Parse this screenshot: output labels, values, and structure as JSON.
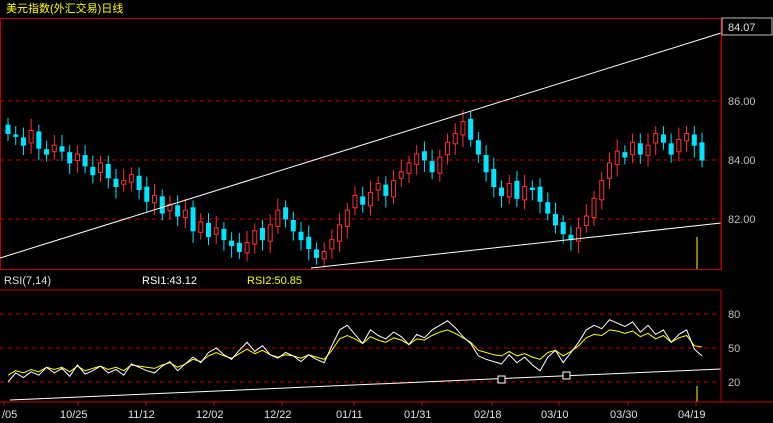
{
  "window_title": "美元指数(外汇交易)日线",
  "price_panel": {
    "current_price_label": "84.07",
    "y_ticks": [
      "86.00",
      "84.00",
      "82.00"
    ]
  },
  "rsi_panel": {
    "title": "RSI(7,14)",
    "rsi1_label": "RSI1:43.12",
    "rsi2_label": "RSI2:50.85",
    "y_ticks": [
      "80",
      "50",
      "20"
    ]
  },
  "x_axis_labels": [
    "/05",
    "10/25",
    "11/12",
    "12/02",
    "12/22",
    "01/11",
    "01/31",
    "02/18",
    "03/10",
    "03/30",
    "04/19"
  ],
  "colors": {
    "background": "#000000",
    "frame": "#c00000",
    "grid": "#c00000",
    "up_candle": "#ff3030",
    "down_candle": "#00e5ff",
    "title_text": "#ffff00",
    "axis_text": "#c0c0c0",
    "rsi1": "#ffffff",
    "rsi2": "#ffff00",
    "trendline": "#ffffff"
  },
  "chart_data": [
    {
      "type": "candlestick",
      "series": [
        {
          "name": "USD Index daily",
          "close": [
            84.9,
            84.8,
            84.5,
            85.0,
            84.4,
            84.2,
            84.5,
            84.3,
            83.9,
            84.2,
            83.8,
            83.5,
            83.9,
            83.4,
            83.1,
            83.3,
            83.5,
            83.0,
            82.6,
            82.8,
            82.2,
            82.5,
            82.1,
            82.3,
            81.6,
            81.9,
            81.4,
            81.7,
            81.3,
            81.1,
            80.9,
            81.2,
            81.6,
            81.3,
            81.8,
            82.3,
            82.0,
            81.6,
            81.3,
            81.0,
            80.7,
            80.9,
            81.3,
            81.8,
            82.3,
            82.8,
            82.5,
            82.9,
            83.2,
            82.8,
            83.3,
            83.6,
            83.9,
            84.2,
            84.0,
            83.6,
            84.1,
            84.6,
            84.9,
            85.3,
            84.7,
            84.2,
            83.6,
            83.1,
            82.8,
            83.2,
            82.7,
            83.1,
            83.0,
            82.6,
            82.2,
            81.8,
            81.5,
            81.3,
            81.7,
            82.1,
            82.7,
            83.3,
            83.9,
            84.3,
            84.1,
            84.6,
            84.2,
            84.5,
            84.9,
            84.6,
            84.2,
            84.7,
            84.9,
            84.5,
            84.0
          ]
        }
      ],
      "ylim": [
        80.6,
        87.8
      ],
      "y_ticks": [
        82.0,
        84.0,
        86.0
      ],
      "last_price": 84.07,
      "trendlines": [
        "upper channel line",
        "lower channel line"
      ],
      "grid": true
    },
    {
      "type": "line",
      "title": "RSI(7,14)",
      "series": [
        {
          "name": "RSI1",
          "values": [
            20,
            28,
            24,
            29,
            26,
            33,
            28,
            32,
            25,
            35,
            27,
            30,
            34,
            28,
            31,
            26,
            36,
            33,
            30,
            28,
            34,
            38,
            30,
            36,
            42,
            37,
            46,
            50,
            44,
            40,
            48,
            55,
            47,
            52,
            44,
            41,
            46,
            43,
            38,
            44,
            40,
            37,
            52,
            66,
            70,
            62,
            54,
            66,
            61,
            58,
            64,
            60,
            53,
            62,
            59,
            66,
            70,
            74,
            68,
            60,
            54,
            43,
            40,
            38,
            36,
            44,
            37,
            42,
            35,
            30,
            42,
            48,
            37,
            46,
            55,
            66,
            70,
            67,
            75,
            72,
            69,
            73,
            64,
            70,
            62,
            66,
            55,
            62,
            66,
            49,
            43
          ]
        },
        {
          "name": "RSI2",
          "values": [
            26,
            30,
            28,
            31,
            29,
            33,
            31,
            33,
            29,
            34,
            30,
            32,
            34,
            31,
            33,
            30,
            35,
            34,
            33,
            32,
            35,
            37,
            33,
            36,
            40,
            38,
            43,
            46,
            43,
            41,
            45,
            49,
            45,
            48,
            44,
            42,
            44,
            43,
            41,
            44,
            42,
            40,
            48,
            58,
            61,
            58,
            54,
            60,
            57,
            55,
            59,
            57,
            53,
            58,
            57,
            61,
            64,
            66,
            63,
            59,
            55,
            48,
            46,
            44,
            43,
            47,
            43,
            45,
            42,
            40,
            46,
            48,
            43,
            47,
            52,
            59,
            62,
            61,
            66,
            65,
            63,
            65,
            60,
            63,
            58,
            61,
            55,
            59,
            61,
            52,
            50.85
          ]
        }
      ],
      "ylim": [
        3,
        97
      ],
      "y_ticks": [
        20,
        50,
        80
      ],
      "grid": true
    }
  ]
}
